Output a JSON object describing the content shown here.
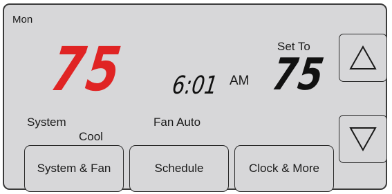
{
  "display": {
    "day": "Mon",
    "current_temp": "75",
    "time": "6:01",
    "ampm": "AM",
    "set_to_label": "Set To",
    "set_temp": "75",
    "system_label": "System",
    "system_mode": "Cool",
    "fan_label": "Fan Auto"
  },
  "buttons": {
    "system_fan": "System & Fan",
    "schedule": "Schedule",
    "clock_more": "Clock & More"
  },
  "icons": {
    "up": "triangle-up-icon",
    "down": "triangle-down-icon"
  },
  "colors": {
    "current_temp": "#e02424",
    "screen_bg": "#d7d7d9"
  }
}
